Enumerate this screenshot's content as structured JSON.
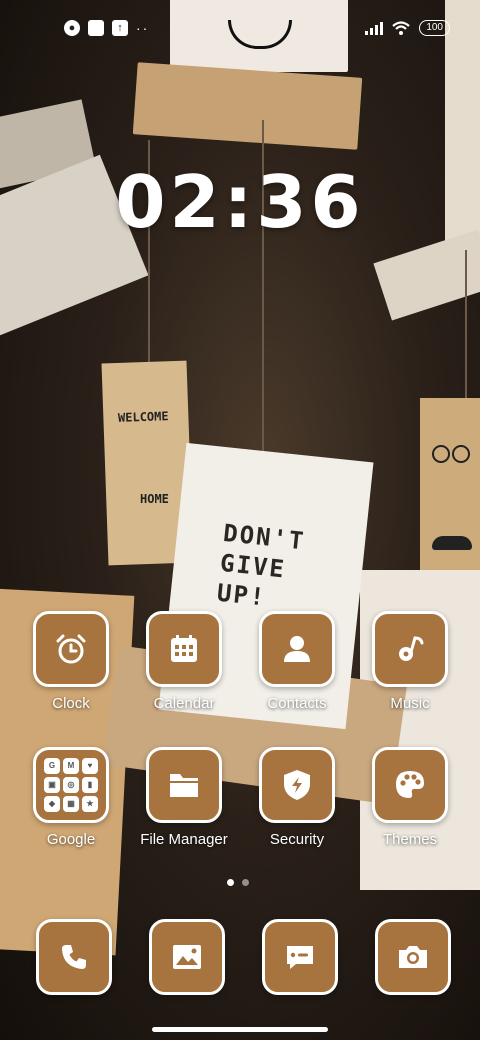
{
  "status_bar": {
    "left_icons": [
      "notification-app-icon",
      "notification-square-icon",
      "upload-icon"
    ],
    "more": "··",
    "battery": "100"
  },
  "clock": {
    "time": "02:36"
  },
  "apps": [
    {
      "label": "Clock",
      "icon": "alarm-clock-icon"
    },
    {
      "label": "Calendar",
      "icon": "calendar-icon"
    },
    {
      "label": "Contacts",
      "icon": "contacts-icon"
    },
    {
      "label": "Music",
      "icon": "music-note-icon"
    },
    {
      "label": "Google",
      "icon": "google-folder-icon"
    },
    {
      "label": "File Manager",
      "icon": "folder-icon"
    },
    {
      "label": "Security",
      "icon": "shield-icon"
    },
    {
      "label": "Themes",
      "icon": "palette-icon"
    }
  ],
  "folder_apps": [
    "G",
    "M",
    "♥",
    "▣",
    "◎",
    "▮",
    "◆",
    "▦",
    "★"
  ],
  "pager": {
    "pages": 2,
    "active": 0
  },
  "dock": [
    {
      "icon": "phone-icon"
    },
    {
      "icon": "gallery-icon"
    },
    {
      "icon": "messages-icon"
    },
    {
      "icon": "camera-icon"
    }
  ],
  "wallpaper_text": {
    "welcome": "WELCOME",
    "home": "HOME",
    "dont_line1": "DON'T",
    "dont_line2": "GIVE",
    "dont_line3": "UP!"
  },
  "colors": {
    "tile": "#a7733f",
    "tile_border": "#ffffff"
  }
}
